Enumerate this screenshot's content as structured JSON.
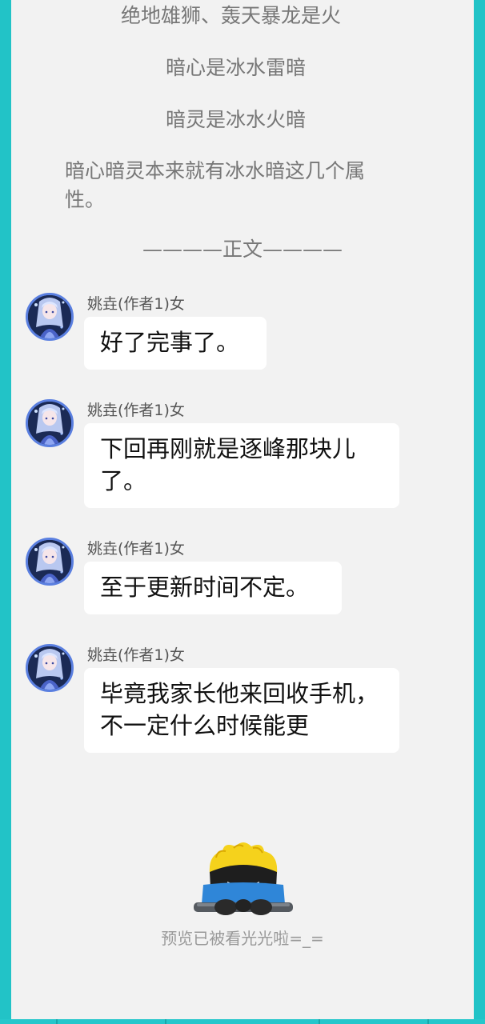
{
  "intro": {
    "line1": "绝地雄狮、轰天暴龙是火",
    "line2": "暗心是冰水雷暗",
    "line3": "暗灵是冰水火暗",
    "paragraph": "暗心暗灵本来就有冰水暗这几个属性。"
  },
  "divider": "————正文————",
  "messages": [
    {
      "sender": "姚垚(作者1)女",
      "text": "好了完事了。"
    },
    {
      "sender": "姚垚(作者1)女",
      "text": "下回再刚就是逐峰那块儿了。"
    },
    {
      "sender": "姚垚(作者1)女",
      "text": "至于更新时间不定。"
    },
    {
      "sender": "姚垚(作者1)女",
      "text": "毕竟我家长他来回收手机，不一定什么时候能更"
    }
  ],
  "preview_end": "预览已被看光光啦=_=",
  "colors": {
    "accent": "#22c3c7",
    "page_bg": "#f2f2f2",
    "bubble_bg": "#ffffff",
    "avatar_ring": "#5a7fe0"
  },
  "icons": {
    "avatar": "anime-girl-avatar-icon",
    "mascot": "peeking-mascot-icon"
  }
}
